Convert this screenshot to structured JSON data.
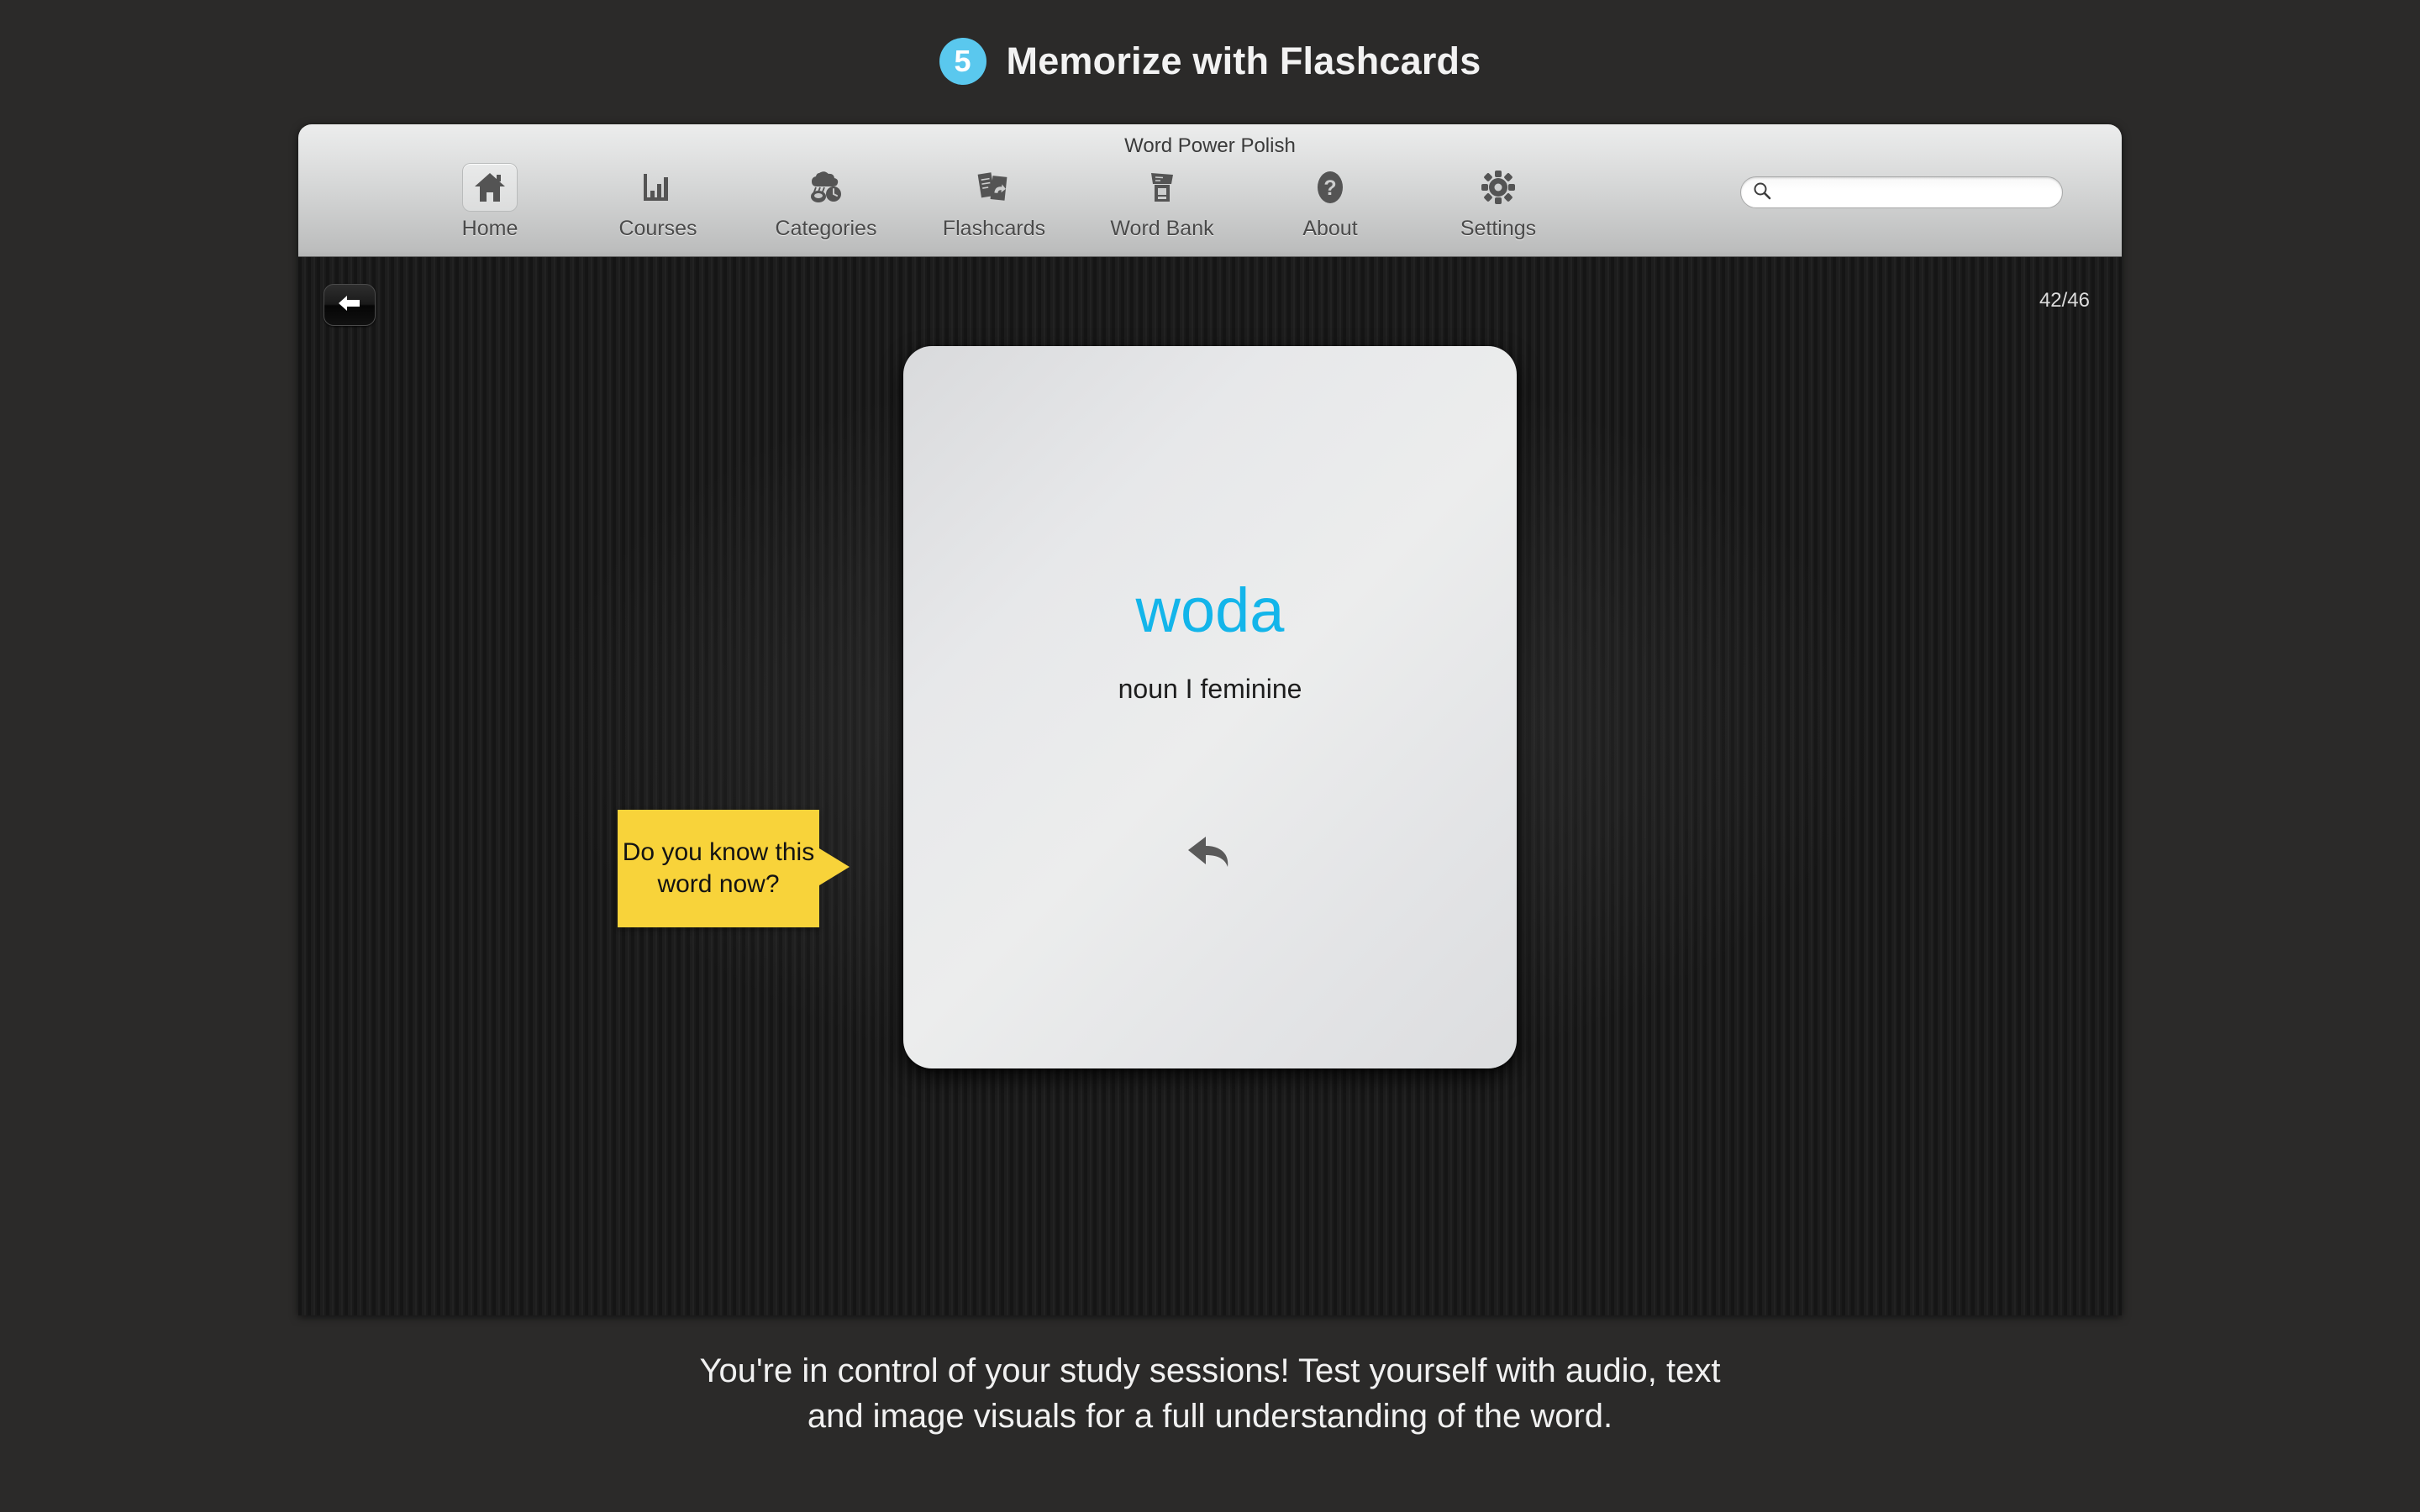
{
  "header": {
    "step_number": "5",
    "title": "Memorize with Flashcards",
    "badge_color": "#5ac8ee"
  },
  "window": {
    "title": "Word Power Polish",
    "toolbar": {
      "items": [
        {
          "label": "Home",
          "icon": "home-icon",
          "selected": true
        },
        {
          "label": "Courses",
          "icon": "bar-chart-icon",
          "selected": false
        },
        {
          "label": "Categories",
          "icon": "categories-icon",
          "selected": false
        },
        {
          "label": "Flashcards",
          "icon": "flashcards-icon",
          "selected": false
        },
        {
          "label": "Word Bank",
          "icon": "word-bank-icon",
          "selected": false
        },
        {
          "label": "About",
          "icon": "question-icon",
          "selected": false
        },
        {
          "label": "Settings",
          "icon": "gear-icon",
          "selected": false
        }
      ],
      "search": {
        "icon": "search-icon",
        "value": "",
        "placeholder": ""
      }
    }
  },
  "content": {
    "back_button_icon": "arrow-left-icon",
    "counter": "42/46",
    "flashcard": {
      "word": "woda",
      "part_of_speech": "noun I feminine",
      "word_color": "#13b5ea",
      "flip_icon": "undo-arrow-icon"
    },
    "callout": {
      "line1": "Do you",
      "line2": "know this",
      "line3": "word now?",
      "color": "#f8d33a"
    }
  },
  "caption": {
    "line1": "You're in control of your study sessions! Test yourself with audio, text",
    "line2": "and image visuals for a full understanding of the word."
  }
}
